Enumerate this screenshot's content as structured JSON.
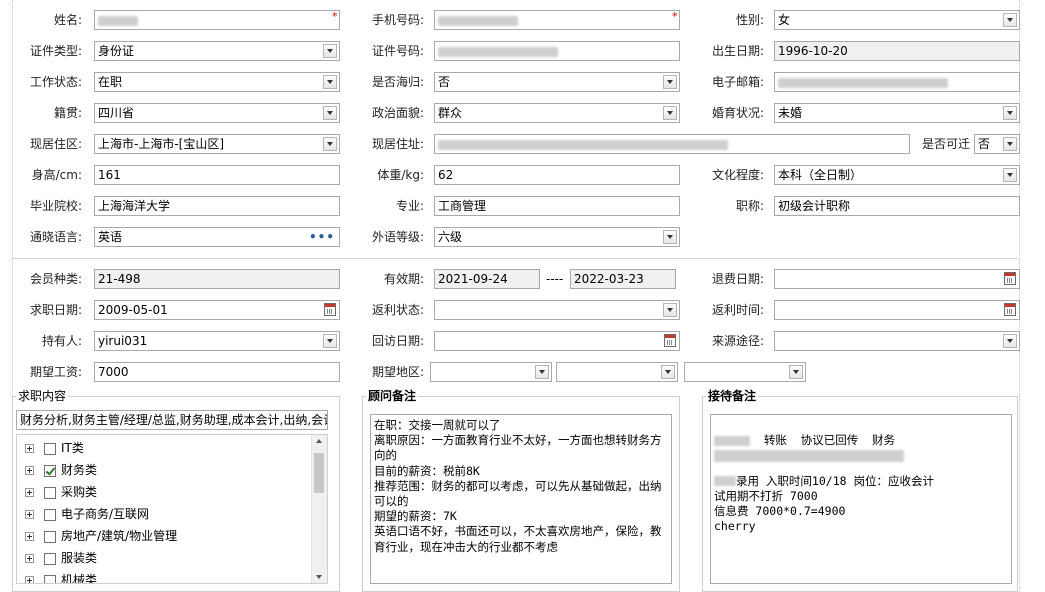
{
  "basic": {
    "name_label": "姓名:",
    "phone_label": "手机号码:",
    "gender_label": "性别:",
    "gender": "女",
    "id_type_label": "证件类型:",
    "id_type": "身份证",
    "id_no_label": "证件号码:",
    "birth_label": "出生日期:",
    "birth": "1996-10-20",
    "work_status_label": "工作状态:",
    "work_status": "在职",
    "overseas_label": "是否海归:",
    "overseas": "否",
    "email_label": "电子邮箱:",
    "native_label": "籍贯:",
    "native": "四川省",
    "political_label": "政治面貌:",
    "political": "群众",
    "marital_label": "婚育状况:",
    "marital": "未婚",
    "area_label": "现居住区:",
    "area": "上海市-上海市-[宝山区]",
    "address_label": "现居住址:",
    "relocate_label": "是否可迁",
    "relocate": "否",
    "height_label": "身高/cm:",
    "height": "161",
    "weight_label": "体重/kg:",
    "weight": "62",
    "education_label": "文化程度:",
    "education": "本科（全日制）",
    "school_label": "毕业院校:",
    "school": "上海海洋大学",
    "major_label": "专业:",
    "major": "工商管理",
    "title_label": "职称:",
    "title": "初级会计职称",
    "language_label": "通晓语言:",
    "language": "英语",
    "lang_level_label": "外语等级:",
    "lang_level": "六级"
  },
  "member": {
    "type_label": "会员种类:",
    "type": "21-498",
    "valid_label": "有效期:",
    "valid_from": "2021-09-24",
    "valid_sep": "----",
    "valid_to": "2022-03-23",
    "refund_date_label": "退费日期:",
    "refund_date": "",
    "job_date_label": "求职日期:",
    "job_date": "2009-05-01",
    "rebate_status_label": "返利状态:",
    "rebate_status": "",
    "rebate_time_label": "返利时间:",
    "rebate_time": "",
    "holder_label": "持有人:",
    "holder": "yirui031",
    "visit_date_label": "回访日期:",
    "visit_date": "",
    "source_label": "来源途径:",
    "source": "",
    "salary_label": "期望工资:",
    "salary": "7000",
    "region_label": "期望地区:"
  },
  "job_content": {
    "title": "求职内容",
    "summary": "财务分析,财务主管/经理/总监,财务助理,成本会计,出纳,会计",
    "items": [
      {
        "label": "IT类",
        "checked": false
      },
      {
        "label": "财务类",
        "checked": true
      },
      {
        "label": "采购类",
        "checked": false
      },
      {
        "label": "电子商务/互联网",
        "checked": false
      },
      {
        "label": "房地产/建筑/物业管理",
        "checked": false
      },
      {
        "label": "服装类",
        "checked": false
      },
      {
        "label": "机械类",
        "checked": false
      }
    ]
  },
  "advisor_note": {
    "title": "顾问备注",
    "text": "在职：交接一周就可以了\n离职原因：一方面教育行业不太好，一方面也想转财务方向的\n目前的薪资：税前8K\n推荐范围：财务的都可以考虑，可以先从基础做起，出纳可以的\n期望的薪资：7K\n英语口语不好，书面还可以，不太喜欢房地产，保险，教育行业，现在冲击大的行业都不考虑"
  },
  "reception_note": {
    "title": "接待备注",
    "line1": "转账  协议已回传  财务",
    "line3": "录用 入职时间10/18 岗位：应收会计",
    "line4": "试用期不打折 7000",
    "line5": "信息费 7000*0.7=4900",
    "line6": "cherry"
  },
  "icons": {
    "dropdown": "chevron-down-icon",
    "calendar": "calendar-icon",
    "more": "more-dots-icon",
    "required": "required-asterisk-icon",
    "expand": "plus-expand-icon"
  }
}
